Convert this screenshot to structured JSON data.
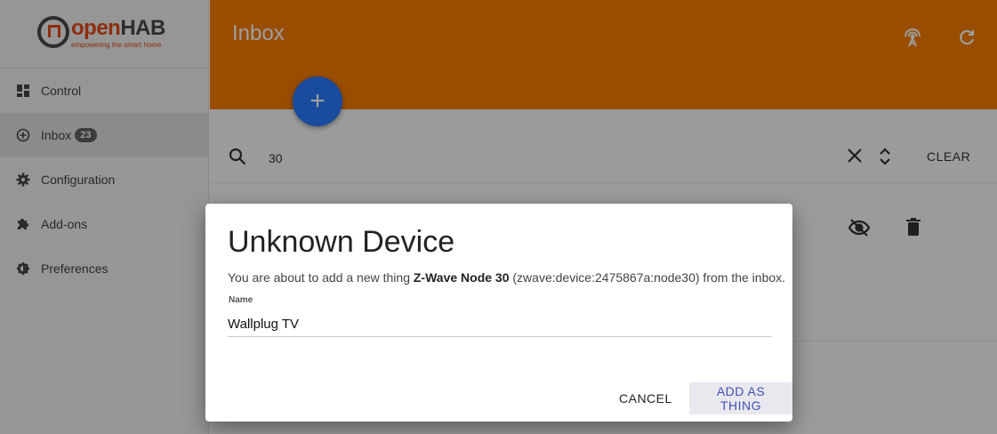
{
  "brand": {
    "logo_o": "o",
    "logo_pen": "pen",
    "logo_hab": "HAB",
    "tagline": "empowering the smart home"
  },
  "sidebar": {
    "items": [
      {
        "label": "Control"
      },
      {
        "label": "Inbox",
        "badge": "23"
      },
      {
        "label": "Configuration"
      },
      {
        "label": "Add-ons"
      },
      {
        "label": "Preferences"
      }
    ]
  },
  "header": {
    "title": "Inbox",
    "color": "#f57c00"
  },
  "fab": {
    "label": "+"
  },
  "search": {
    "value": "30",
    "clear_label": "CLEAR"
  },
  "dialog": {
    "title": "Unknown Device",
    "text_prefix": "You are about to add a new thing ",
    "thing_name": "Z-Wave Node 30",
    "text_suffix": " (zwave:device:2475867a:node30) from the inbox.",
    "field_label": "Name",
    "field_value": "Wallplug TV",
    "cancel_label": "CANCEL",
    "add_label": "ADD AS THING"
  }
}
